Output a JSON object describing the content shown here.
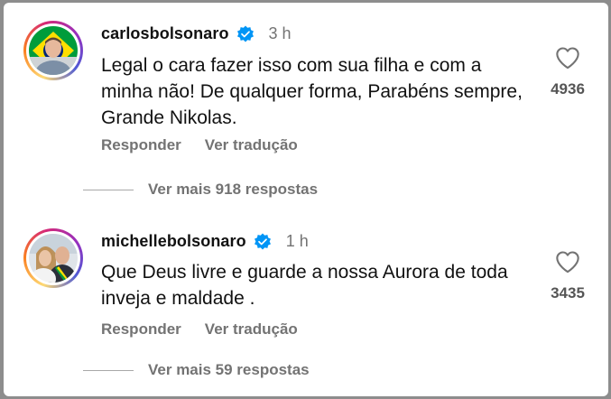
{
  "comments": [
    {
      "username": "carlosbolsonaro",
      "time": "3 h",
      "text": "Legal o cara fazer isso com sua filha e com a minha não! De qualquer forma, Parabéns sempre, Grande Nikolas.",
      "reply_label": "Responder",
      "translate_label": "Ver tradução",
      "likes": "4936",
      "more_replies": "Ver mais 918 respostas"
    },
    {
      "username": "michellebolsonaro",
      "time": "1 h",
      "text": "Que Deus livre e guarde a  nossa Aurora de toda inveja e maldade .",
      "reply_label": "Responder",
      "translate_label": "Ver tradução",
      "likes": "3435",
      "more_replies": "Ver mais 59 respostas"
    }
  ],
  "icons": {
    "verified": "verified-badge-icon",
    "like": "heart-outline-icon"
  },
  "colors": {
    "verified_blue": "#0095f6",
    "muted_text": "#737373",
    "primary_text": "#111111"
  }
}
